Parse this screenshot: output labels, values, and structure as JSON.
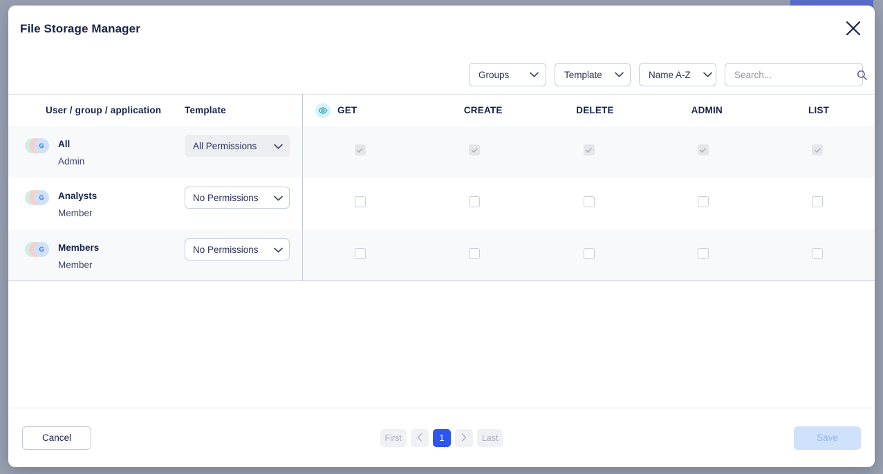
{
  "background": {
    "hidden_chip_color": "#5c6fd0"
  },
  "modal": {
    "title": "File Storage Manager",
    "close_icon": "close-icon"
  },
  "toolbar": {
    "filters": [
      {
        "name": "groups-select",
        "label": "Groups",
        "icon": "chevron-down-icon"
      },
      {
        "name": "template-select",
        "label": "Template",
        "icon": "chevron-down-icon"
      },
      {
        "name": "sort-select",
        "label": "Name A-Z",
        "icon": "chevron-down-icon"
      }
    ],
    "search": {
      "placeholder": "Search...",
      "value": "",
      "icon": "search-icon"
    }
  },
  "table": {
    "left_headers": [
      {
        "name": "header-user-group-application",
        "label": "User / group / application"
      },
      {
        "name": "header-template",
        "label": "Template"
      }
    ],
    "permission_headers": [
      {
        "name": "header-get",
        "label": "GET",
        "icon": "eye-icon",
        "icon_bg": "#d4f4f8"
      },
      {
        "name": "header-create",
        "label": "CREATE"
      },
      {
        "name": "header-delete",
        "label": "DELETE"
      },
      {
        "name": "header-admin",
        "label": "ADMIN"
      },
      {
        "name": "header-list",
        "label": "LIST"
      }
    ],
    "rows": [
      {
        "name": "All",
        "role": "Admin",
        "avatar_letter": "G",
        "template": "All Permissions",
        "template_disabled": true,
        "shaded": true,
        "permissions": [
          {
            "column": "GET",
            "checked": true,
            "disabled": true
          },
          {
            "column": "CREATE",
            "checked": true,
            "disabled": true
          },
          {
            "column": "DELETE",
            "checked": true,
            "disabled": true
          },
          {
            "column": "ADMIN",
            "checked": true,
            "disabled": true
          },
          {
            "column": "LIST",
            "checked": true,
            "disabled": true
          }
        ]
      },
      {
        "name": "Analysts",
        "role": "Member",
        "avatar_letter": "G",
        "template": "No Permissions",
        "template_disabled": false,
        "shaded": false,
        "permissions": [
          {
            "column": "GET",
            "checked": false,
            "disabled": false
          },
          {
            "column": "CREATE",
            "checked": false,
            "disabled": false
          },
          {
            "column": "DELETE",
            "checked": false,
            "disabled": false
          },
          {
            "column": "ADMIN",
            "checked": false,
            "disabled": false
          },
          {
            "column": "LIST",
            "checked": false,
            "disabled": false
          }
        ]
      },
      {
        "name": "Members",
        "role": "Member",
        "avatar_letter": "G",
        "template": "No Permissions",
        "template_disabled": false,
        "shaded": true,
        "permissions": [
          {
            "column": "GET",
            "checked": false,
            "disabled": false
          },
          {
            "column": "CREATE",
            "checked": false,
            "disabled": false
          },
          {
            "column": "DELETE",
            "checked": false,
            "disabled": false
          },
          {
            "column": "ADMIN",
            "checked": false,
            "disabled": false
          },
          {
            "column": "LIST",
            "checked": false,
            "disabled": false
          }
        ]
      }
    ]
  },
  "footer": {
    "cancel_label": "Cancel",
    "save_label": "Save",
    "save_disabled": true,
    "pagination": {
      "first_label": "First",
      "prev_icon": "chevron-left-icon",
      "pages": [
        "1"
      ],
      "current_page": "1",
      "next_icon": "chevron-right-icon",
      "last_label": "Last"
    }
  },
  "colors": {
    "accent_blue": "#2f55f0",
    "title_navy": "#17224a",
    "page_backdrop": "#9aa2b1",
    "row_shaded": "#f8f9fb",
    "get_badge": "#d4f4f8"
  }
}
